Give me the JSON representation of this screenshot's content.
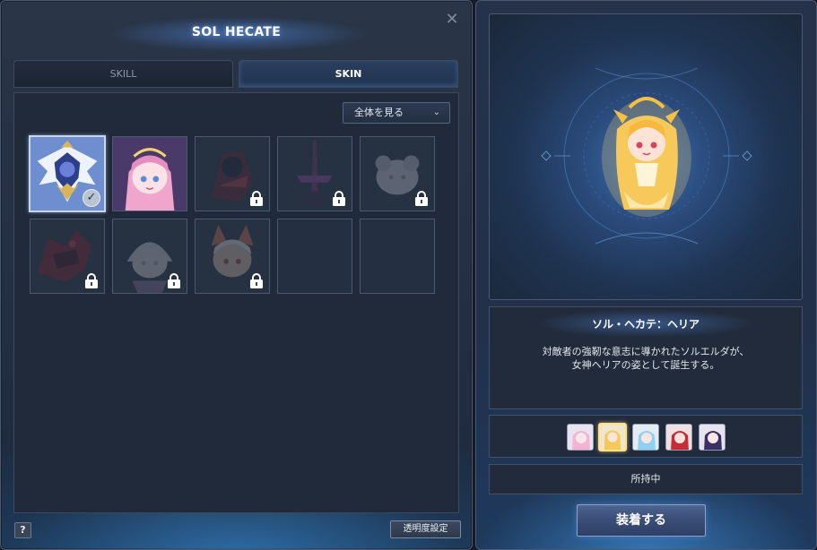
{
  "window": {
    "title": "SOL HECATE",
    "close_label": "✕"
  },
  "tabs": [
    {
      "label": "SKILL",
      "active": false
    },
    {
      "label": "SKIN",
      "active": true
    }
  ],
  "filter": {
    "selected": "全体を見る",
    "chevron": "⌄"
  },
  "skins": [
    {
      "name": "winged-emblem",
      "state": "owned-equipped",
      "palette": [
        "#e9eef9",
        "#2c3f8a",
        "#d8b55a"
      ]
    },
    {
      "name": "pink-goddess",
      "state": "owned",
      "palette": [
        "#f4b9d6",
        "#e58fc0",
        "#f6d26f"
      ]
    },
    {
      "name": "dark-rider",
      "state": "locked",
      "palette": [
        "#6a2030",
        "#1b1f2c",
        "#c03a40"
      ]
    },
    {
      "name": "sword-shadow",
      "state": "locked",
      "palette": [
        "#3a2a4a",
        "#7b3a6a",
        "#a04aa0"
      ]
    },
    {
      "name": "white-puff",
      "state": "locked",
      "palette": [
        "#e8e6ef",
        "#cfcbd8",
        "#a39fb0"
      ]
    },
    {
      "name": "crimson-dragon",
      "state": "locked",
      "palette": [
        "#8a1f28",
        "#4a1018",
        "#c7404a"
      ]
    },
    {
      "name": "silver-chibi",
      "state": "locked",
      "palette": [
        "#e2e4ea",
        "#b4b8c4",
        "#8a7aa0"
      ]
    },
    {
      "name": "fox-girl",
      "state": "locked",
      "palette": [
        "#f2d2b4",
        "#e07a4a",
        "#ffffff"
      ]
    },
    {
      "name": "empty-slot-1",
      "state": "empty",
      "palette": []
    },
    {
      "name": "empty-slot-2",
      "state": "empty",
      "palette": []
    }
  ],
  "footer": {
    "help_label": "?",
    "opacity_label": "透明度設定"
  },
  "detail": {
    "skin_name": "ソル・ヘカテ：ヘリア",
    "description": "対敵者の強靭な意志に導かれたソルエルダが、\n女神ヘリアの姿として誕生する。",
    "color_variants": [
      {
        "name": "pink",
        "hair": "#f3b4d4",
        "active": false
      },
      {
        "name": "gold",
        "hair": "#f5c85a",
        "active": true
      },
      {
        "name": "blue",
        "hair": "#8fd0f2",
        "active": false
      },
      {
        "name": "red",
        "hair": "#c62c36",
        "active": false
      },
      {
        "name": "purple",
        "hair": "#3b2f66",
        "active": false
      }
    ],
    "status": "所持中",
    "equip_label": "装着する"
  },
  "colors": {
    "accent": "#4d6590",
    "selected_border": "#ffe08a",
    "panel_bg": "#243044"
  }
}
